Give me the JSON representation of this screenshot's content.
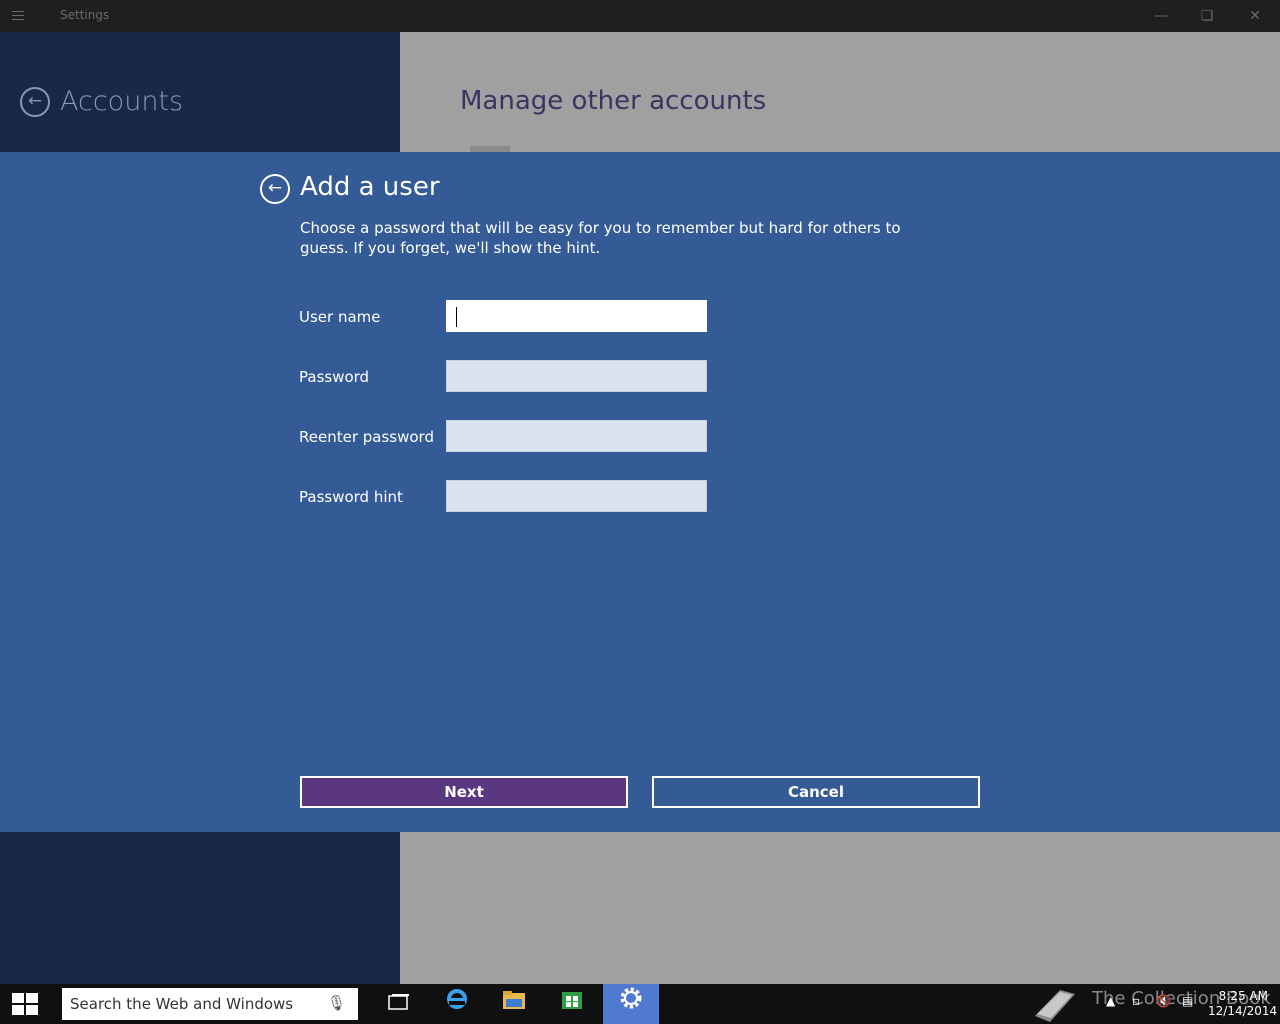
{
  "window": {
    "title": "Settings"
  },
  "nav": {
    "section_title": "Accounts"
  },
  "content": {
    "page_title": "Manage other accounts"
  },
  "dialog": {
    "title": "Add a user",
    "description": "Choose a password that will be easy for you to remember but hard for others to guess. If you forget, we'll show the hint.",
    "fields": [
      {
        "label": "User name",
        "value": ""
      },
      {
        "label": "Password",
        "value": ""
      },
      {
        "label": "Reenter password",
        "value": ""
      },
      {
        "label": "Password hint",
        "value": ""
      }
    ],
    "next_label": "Next",
    "cancel_label": "Cancel",
    "accent_color": "#345b95",
    "next_color": "#5b3782"
  },
  "taskbar": {
    "search_placeholder": "Search the Web and Windows",
    "time": "8:25 AM",
    "date": "12/14/2014",
    "watermark": "The Collection Book"
  }
}
